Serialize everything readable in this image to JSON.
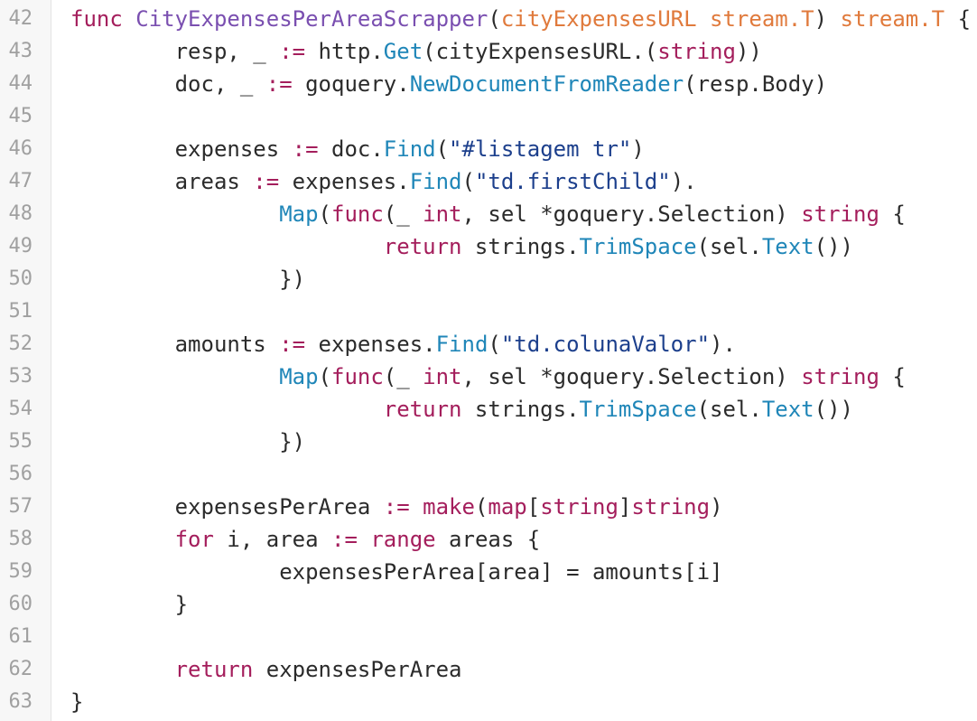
{
  "colors": {
    "keyword": "#a41e5c",
    "function_name": "#7a4fb0",
    "parameter": "#e07a3c",
    "method_call": "#1f86b8",
    "string": "#1c3f8c",
    "plain": "#2b2b2b",
    "line_number": "#a0a0a0",
    "gutter_background": "#f7f7f7"
  },
  "lines": [
    {
      "n": "42",
      "tokens": [
        {
          "t": "kw",
          "v": "func "
        },
        {
          "t": "fnname",
          "v": "CityExpensesPerAreaScrapper"
        },
        {
          "t": "plain",
          "v": "("
        },
        {
          "t": "param",
          "v": "cityExpensesURL stream.T"
        },
        {
          "t": "plain",
          "v": ") "
        },
        {
          "t": "param",
          "v": "stream.T"
        },
        {
          "t": "plain",
          "v": " {"
        }
      ]
    },
    {
      "n": "43",
      "tokens": [
        {
          "t": "plain",
          "v": "        resp, _ "
        },
        {
          "t": "kw",
          "v": ":="
        },
        {
          "t": "plain",
          "v": " http."
        },
        {
          "t": "call",
          "v": "Get"
        },
        {
          "t": "plain",
          "v": "(cityExpensesURL.("
        },
        {
          "t": "kw",
          "v": "string"
        },
        {
          "t": "plain",
          "v": "))"
        }
      ]
    },
    {
      "n": "44",
      "tokens": [
        {
          "t": "plain",
          "v": "        doc, _ "
        },
        {
          "t": "kw",
          "v": ":="
        },
        {
          "t": "plain",
          "v": " goquery."
        },
        {
          "t": "call",
          "v": "NewDocumentFromReader"
        },
        {
          "t": "plain",
          "v": "(resp.Body)"
        }
      ]
    },
    {
      "n": "45",
      "tokens": []
    },
    {
      "n": "46",
      "tokens": [
        {
          "t": "plain",
          "v": "        expenses "
        },
        {
          "t": "kw",
          "v": ":="
        },
        {
          "t": "plain",
          "v": " doc."
        },
        {
          "t": "call",
          "v": "Find"
        },
        {
          "t": "plain",
          "v": "("
        },
        {
          "t": "str",
          "v": "\"#listagem tr\""
        },
        {
          "t": "plain",
          "v": ")"
        }
      ]
    },
    {
      "n": "47",
      "tokens": [
        {
          "t": "plain",
          "v": "        areas "
        },
        {
          "t": "kw",
          "v": ":="
        },
        {
          "t": "plain",
          "v": " expenses."
        },
        {
          "t": "call",
          "v": "Find"
        },
        {
          "t": "plain",
          "v": "("
        },
        {
          "t": "str",
          "v": "\"td.firstChild\""
        },
        {
          "t": "plain",
          "v": ")."
        }
      ]
    },
    {
      "n": "48",
      "tokens": [
        {
          "t": "plain",
          "v": "                "
        },
        {
          "t": "call",
          "v": "Map"
        },
        {
          "t": "plain",
          "v": "("
        },
        {
          "t": "kw",
          "v": "func"
        },
        {
          "t": "plain",
          "v": "(_ "
        },
        {
          "t": "kw",
          "v": "int"
        },
        {
          "t": "plain",
          "v": ", sel *goquery.Selection) "
        },
        {
          "t": "kw",
          "v": "string"
        },
        {
          "t": "plain",
          "v": " {"
        }
      ]
    },
    {
      "n": "49",
      "tokens": [
        {
          "t": "plain",
          "v": "                        "
        },
        {
          "t": "kw",
          "v": "return"
        },
        {
          "t": "plain",
          "v": " strings."
        },
        {
          "t": "call",
          "v": "TrimSpace"
        },
        {
          "t": "plain",
          "v": "(sel."
        },
        {
          "t": "call",
          "v": "Text"
        },
        {
          "t": "plain",
          "v": "())"
        }
      ]
    },
    {
      "n": "50",
      "tokens": [
        {
          "t": "plain",
          "v": "                })"
        }
      ]
    },
    {
      "n": "51",
      "tokens": []
    },
    {
      "n": "52",
      "tokens": [
        {
          "t": "plain",
          "v": "        amounts "
        },
        {
          "t": "kw",
          "v": ":="
        },
        {
          "t": "plain",
          "v": " expenses."
        },
        {
          "t": "call",
          "v": "Find"
        },
        {
          "t": "plain",
          "v": "("
        },
        {
          "t": "str",
          "v": "\"td.colunaValor\""
        },
        {
          "t": "plain",
          "v": ")."
        }
      ]
    },
    {
      "n": "53",
      "tokens": [
        {
          "t": "plain",
          "v": "                "
        },
        {
          "t": "call",
          "v": "Map"
        },
        {
          "t": "plain",
          "v": "("
        },
        {
          "t": "kw",
          "v": "func"
        },
        {
          "t": "plain",
          "v": "(_ "
        },
        {
          "t": "kw",
          "v": "int"
        },
        {
          "t": "plain",
          "v": ", sel *goquery.Selection) "
        },
        {
          "t": "kw",
          "v": "string"
        },
        {
          "t": "plain",
          "v": " {"
        }
      ]
    },
    {
      "n": "54",
      "tokens": [
        {
          "t": "plain",
          "v": "                        "
        },
        {
          "t": "kw",
          "v": "return"
        },
        {
          "t": "plain",
          "v": " strings."
        },
        {
          "t": "call",
          "v": "TrimSpace"
        },
        {
          "t": "plain",
          "v": "(sel."
        },
        {
          "t": "call",
          "v": "Text"
        },
        {
          "t": "plain",
          "v": "())"
        }
      ]
    },
    {
      "n": "55",
      "tokens": [
        {
          "t": "plain",
          "v": "                })"
        }
      ]
    },
    {
      "n": "56",
      "tokens": []
    },
    {
      "n": "57",
      "tokens": [
        {
          "t": "plain",
          "v": "        expensesPerArea "
        },
        {
          "t": "kw",
          "v": ":="
        },
        {
          "t": "plain",
          "v": " "
        },
        {
          "t": "kw",
          "v": "make"
        },
        {
          "t": "plain",
          "v": "("
        },
        {
          "t": "kw",
          "v": "map"
        },
        {
          "t": "plain",
          "v": "["
        },
        {
          "t": "kw",
          "v": "string"
        },
        {
          "t": "plain",
          "v": "]"
        },
        {
          "t": "kw",
          "v": "string"
        },
        {
          "t": "plain",
          "v": ")"
        }
      ]
    },
    {
      "n": "58",
      "tokens": [
        {
          "t": "plain",
          "v": "        "
        },
        {
          "t": "kw",
          "v": "for"
        },
        {
          "t": "plain",
          "v": " i, area "
        },
        {
          "t": "kw",
          "v": ":="
        },
        {
          "t": "plain",
          "v": " "
        },
        {
          "t": "kw",
          "v": "range"
        },
        {
          "t": "plain",
          "v": " areas {"
        }
      ]
    },
    {
      "n": "59",
      "tokens": [
        {
          "t": "plain",
          "v": "                expensesPerArea[area] = amounts[i]"
        }
      ]
    },
    {
      "n": "60",
      "tokens": [
        {
          "t": "plain",
          "v": "        }"
        }
      ]
    },
    {
      "n": "61",
      "tokens": []
    },
    {
      "n": "62",
      "tokens": [
        {
          "t": "plain",
          "v": "        "
        },
        {
          "t": "kw",
          "v": "return"
        },
        {
          "t": "plain",
          "v": " expensesPerArea"
        }
      ]
    },
    {
      "n": "63",
      "tokens": [
        {
          "t": "plain",
          "v": "}"
        }
      ]
    }
  ]
}
